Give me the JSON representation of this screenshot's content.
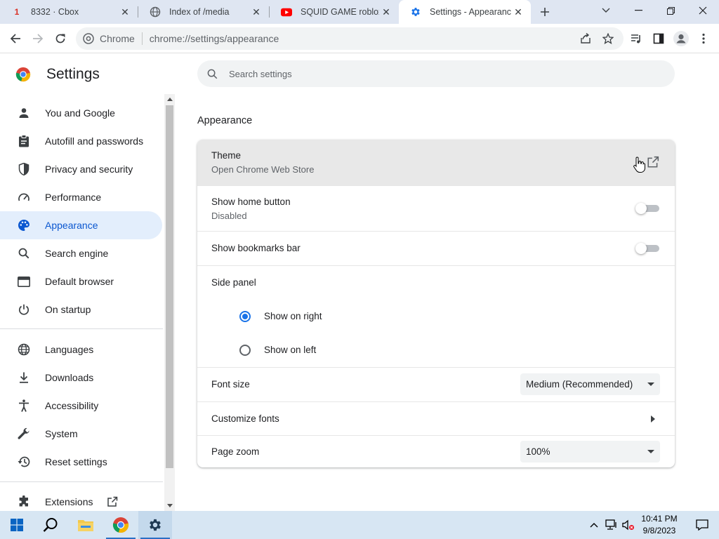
{
  "browser": {
    "tabs": [
      {
        "title": "8332 · Cbox",
        "favicon_text": "1"
      },
      {
        "title": "Index of /media"
      },
      {
        "title": "SQUID GAME roblox -"
      },
      {
        "title": "Settings - Appearance",
        "active": true
      }
    ],
    "omnibox": {
      "chip_label": "Chrome",
      "url": "chrome://settings/appearance"
    }
  },
  "settings": {
    "title": "Settings",
    "search_placeholder": "Search settings",
    "nav": [
      {
        "label": "You and Google"
      },
      {
        "label": "Autofill and passwords"
      },
      {
        "label": "Privacy and security"
      },
      {
        "label": "Performance"
      },
      {
        "label": "Appearance",
        "selected": true
      },
      {
        "label": "Search engine"
      },
      {
        "label": "Default browser"
      },
      {
        "label": "On startup"
      },
      {
        "label": "Languages"
      },
      {
        "label": "Downloads"
      },
      {
        "label": "Accessibility"
      },
      {
        "label": "System"
      },
      {
        "label": "Reset settings"
      },
      {
        "label": "Extensions"
      }
    ],
    "section_title": "Appearance",
    "theme": {
      "label": "Theme",
      "sub": "Open Chrome Web Store"
    },
    "home_button": {
      "label": "Show home button",
      "sub": "Disabled",
      "enabled": false
    },
    "bookmarks_bar": {
      "label": "Show bookmarks bar",
      "enabled": false
    },
    "side_panel": {
      "label": "Side panel",
      "options": [
        "Show on right",
        "Show on left"
      ],
      "selected": "Show on right"
    },
    "font_size": {
      "label": "Font size",
      "value": "Medium (Recommended)"
    },
    "customize_fonts": {
      "label": "Customize fonts"
    },
    "page_zoom": {
      "label": "Page zoom",
      "value": "100%"
    }
  },
  "taskbar": {
    "time": "10:41 PM",
    "date": "9/8/2023"
  },
  "colors": {
    "accent": "#1a73e8",
    "nav_selected_bg": "#e3eefc",
    "tabstrip_bg": "#dfe6f2",
    "taskbar_bg": "#d7e6f3"
  }
}
